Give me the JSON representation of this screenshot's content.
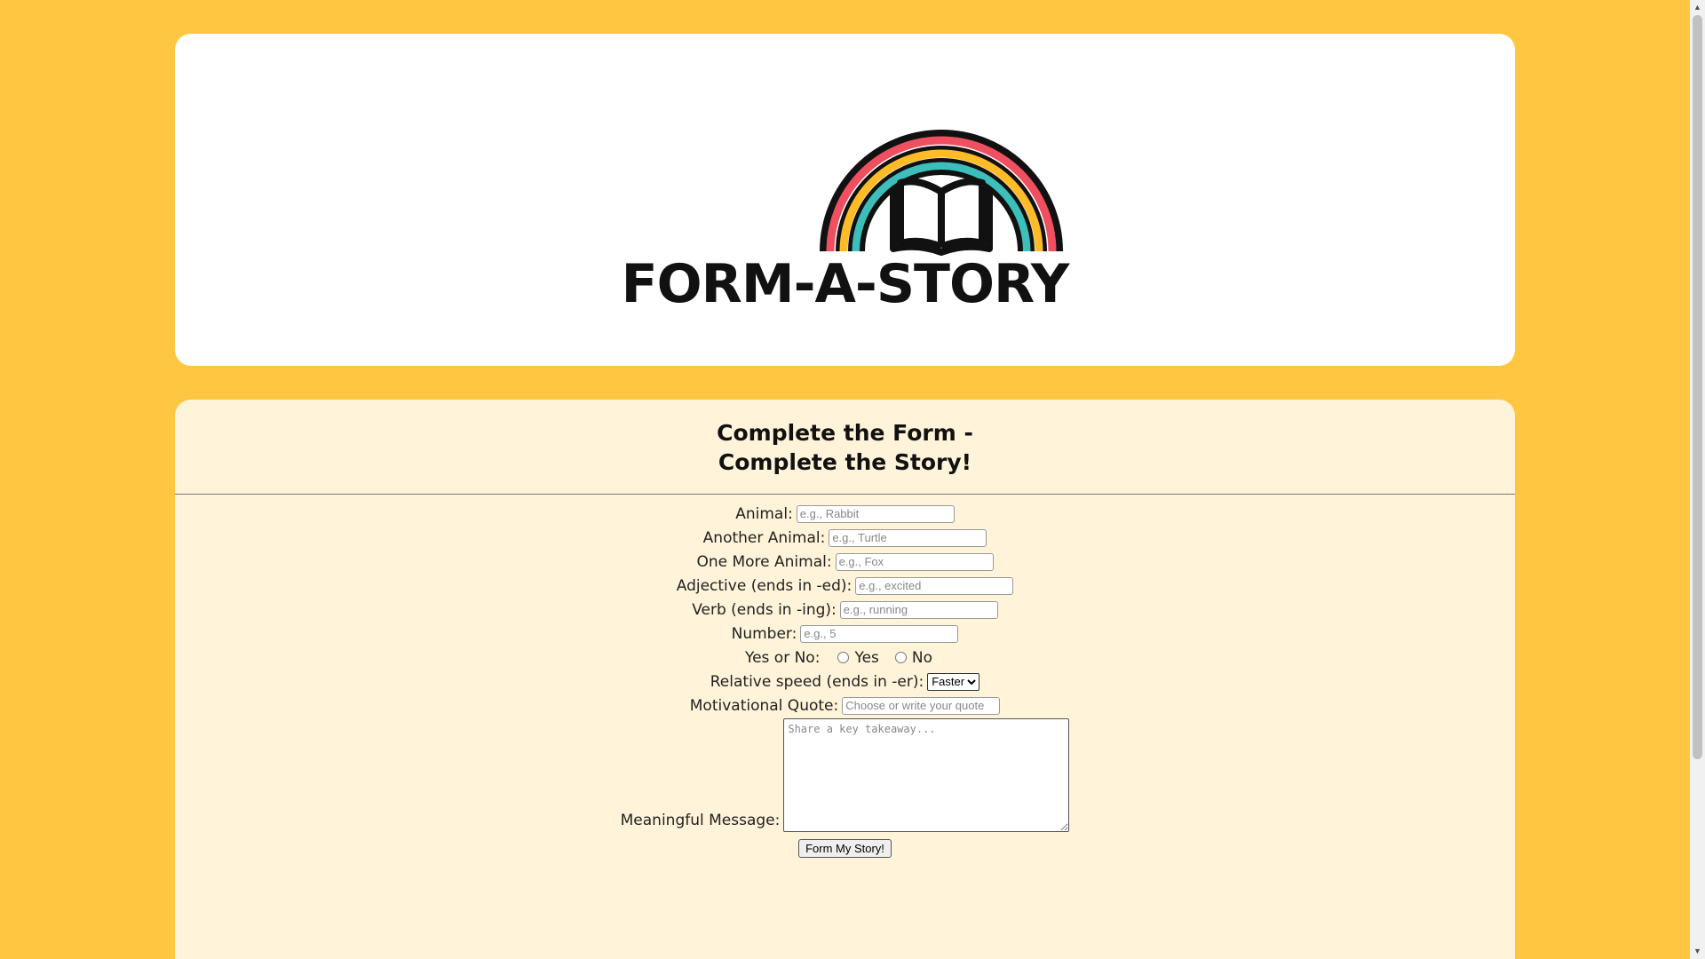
{
  "header": {
    "logo_text": "FORM-A-STORY"
  },
  "form": {
    "title_line1": "Complete the Form -",
    "title_line2": "Complete the Story!",
    "animal": {
      "label": "Animal:",
      "placeholder": "e.g., Rabbit"
    },
    "another_animal": {
      "label": "Another Animal:",
      "placeholder": "e.g., Turtle"
    },
    "one_more_animal": {
      "label": "One More Animal:",
      "placeholder": "e.g., Fox"
    },
    "adjective": {
      "label": "Adjective (ends in -ed):",
      "placeholder": "e.g., excited"
    },
    "verb": {
      "label": "Verb (ends in -ing):",
      "placeholder": "e.g., running"
    },
    "number": {
      "label": "Number:",
      "placeholder": "e.g., 5"
    },
    "yes_no": {
      "label": "Yes or No:",
      "yes_label": "Yes",
      "no_label": "No"
    },
    "relative_speed": {
      "label": "Relative speed (ends in -er):",
      "selected": "Faster"
    },
    "motivational_quote": {
      "label": "Motivational Quote:",
      "placeholder": "Choose or write your quote"
    },
    "meaningful_message": {
      "label": "Meaningful Message:",
      "placeholder": "Share a key takeaway..."
    },
    "submit_label": "Form My Story!"
  },
  "colors": {
    "background": "#ffc641",
    "form_card": "#fff3d9",
    "rainbow_red": "#ef4f5f",
    "rainbow_yellow": "#ffbc26",
    "rainbow_teal": "#3cbfba"
  },
  "icons": {
    "logo": "rainbow-book-icon",
    "scroll_up": "chevron-up-icon",
    "scroll_down": "chevron-down-icon"
  }
}
